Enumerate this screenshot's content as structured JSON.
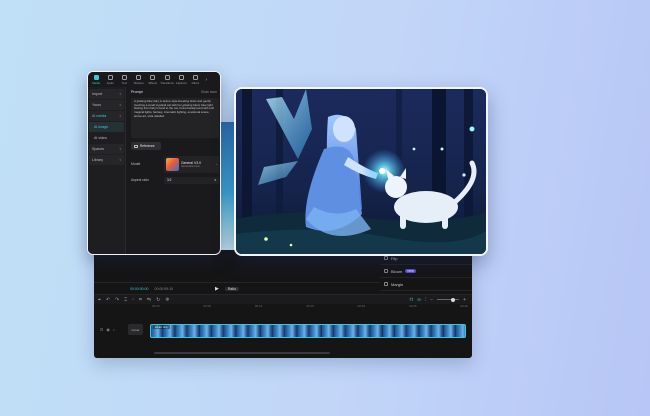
{
  "panel": {
    "tabs": [
      {
        "label": "Media",
        "icon": "media-icon",
        "active": true
      },
      {
        "label": "Audio",
        "icon": "audio-icon"
      },
      {
        "label": "Text",
        "icon": "text-icon"
      },
      {
        "label": "Stickers",
        "icon": "sticker-icon"
      },
      {
        "label": "Effects",
        "icon": "effects-icon"
      },
      {
        "label": "Transitions",
        "icon": "transitions-icon"
      },
      {
        "label": "Captions",
        "icon": "captions-icon"
      },
      {
        "label": "Filters",
        "icon": "filters-icon"
      }
    ],
    "more": "›",
    "sidebar": {
      "import_label": "Import",
      "yours_label": "Yours",
      "ai_media_label": "AI media",
      "ai_image_label": "AI image",
      "ai_video_label": "AI video",
      "spaces_label": "Spaces",
      "library_label": "Library"
    },
    "prompt_title": "Prompt",
    "prompt_link": "Show more",
    "prompt_text": "A glowing blue fairy in anime style kneeling down and gently touching a small mystical cat with her glowing hand, blue light flowing from fairy's hand to the cat, forest background with soft magical lights, fantasy, cinematic lighting, emotional scene, anime art, ultra detailed",
    "reference_label": "Reference",
    "model_label": "Model",
    "model_name": "General V3.0",
    "model_sub": "Generation best...",
    "aspect_label": "Aspect ratio",
    "aspect_value": "3:2"
  },
  "editor": {
    "props": [
      "Flip",
      "Bloom"
    ],
    "props_tag": "new",
    "props_third": "Margin",
    "player_time": "00:00:00:00",
    "player_total": "00:00:09:10",
    "ratio_pill": "Ratio",
    "clip_label": "AI art clip",
    "cover_label": "Cover",
    "ruler": [
      "00:00",
      "00:05",
      "00:10",
      "00:15",
      "00:20",
      "00:25",
      "00:30"
    ]
  },
  "colors": {
    "accent": "#3ec9d6",
    "purple_tag": "#5b4ed6",
    "panel_bg": "#1a1a1c"
  }
}
